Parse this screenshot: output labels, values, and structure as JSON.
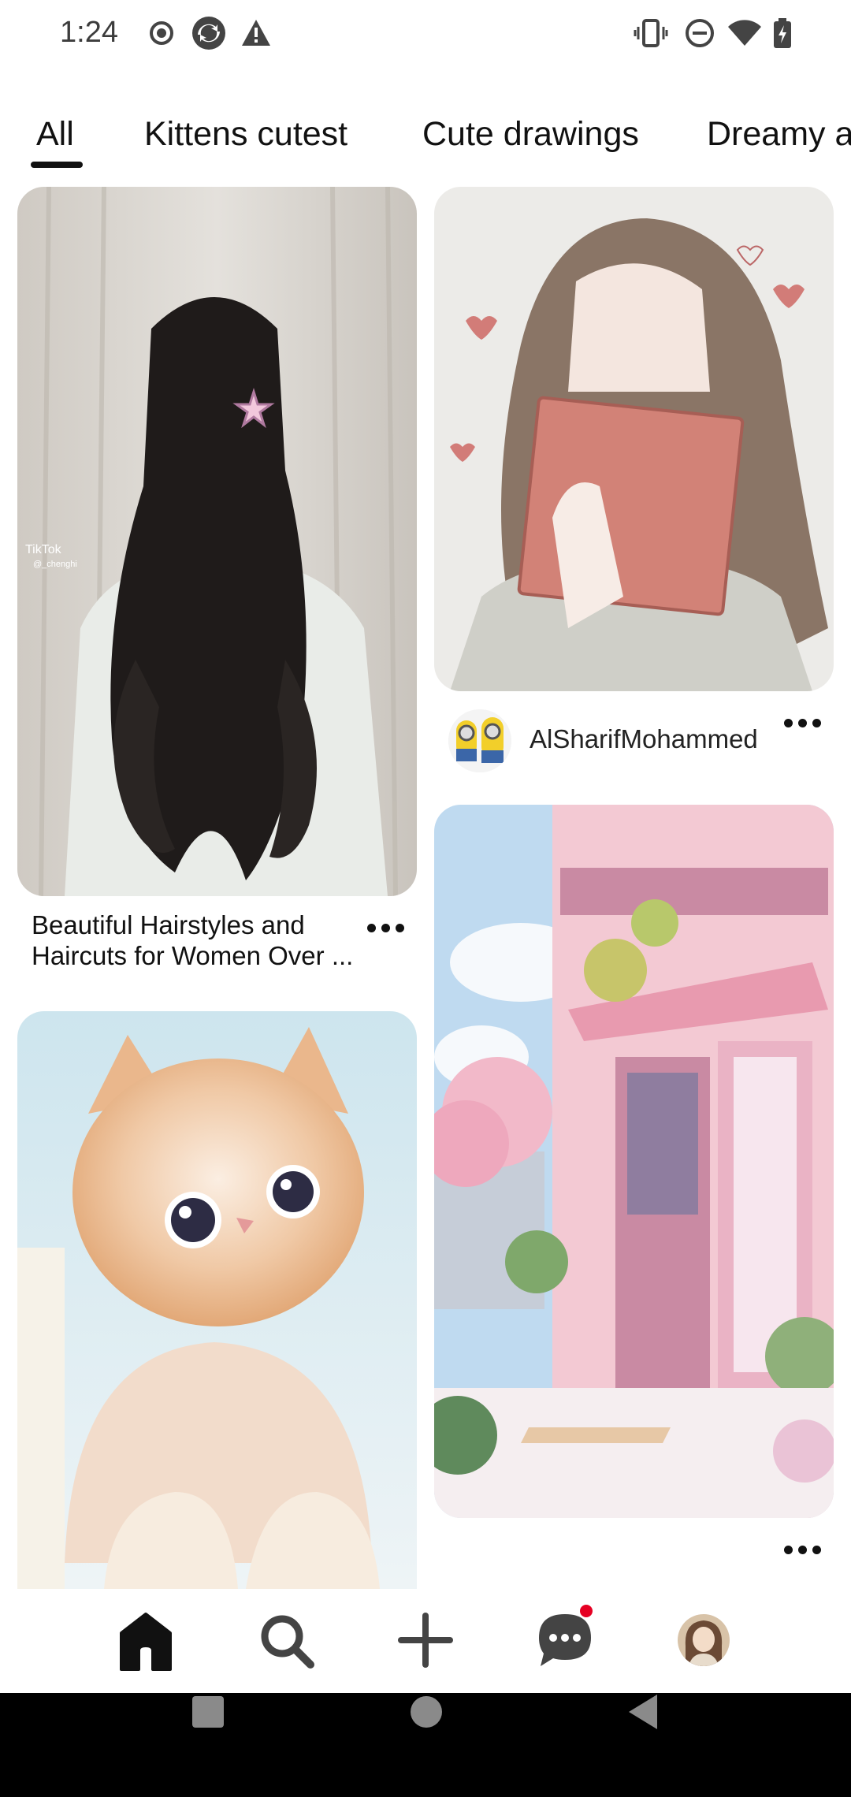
{
  "status_bar": {
    "time": "1:24",
    "left_icons": [
      "record-icon",
      "sync-icon",
      "warning-icon"
    ],
    "right_icons": [
      "vibrate-icon",
      "do-not-disturb-icon",
      "wifi-icon",
      "battery-charging-icon"
    ]
  },
  "tabs": [
    {
      "label": "All",
      "selected": true
    },
    {
      "label": "Kittens cutest",
      "selected": false
    },
    {
      "label": "Cute drawings",
      "selected": false
    },
    {
      "label": "Dreamy a",
      "selected": false
    }
  ],
  "pins": [
    {
      "image": "girl-hairstyle-photo",
      "overlay_logo": "TikTok",
      "overlay_handle": "@_chenghi",
      "title": "Beautiful Hairstyles and Haircuts for Women Over ..."
    },
    {
      "image": "anime-girl-book-illustration",
      "creator": "AlSharifMohammed"
    },
    {
      "image": "kitten-photo"
    },
    {
      "image": "pink-shop-street-illustration"
    }
  ],
  "bottom_nav": [
    {
      "name": "home",
      "icon": "home-icon",
      "selected": true
    },
    {
      "name": "search",
      "icon": "search-icon",
      "selected": false
    },
    {
      "name": "create",
      "icon": "plus-icon",
      "selected": false
    },
    {
      "name": "messages",
      "icon": "chat-icon",
      "selected": false,
      "has_badge": true
    },
    {
      "name": "profile",
      "icon": "avatar",
      "selected": false
    }
  ],
  "colors": {
    "badge": "#e60023",
    "text": "#111111",
    "system_nav": "#000000"
  }
}
